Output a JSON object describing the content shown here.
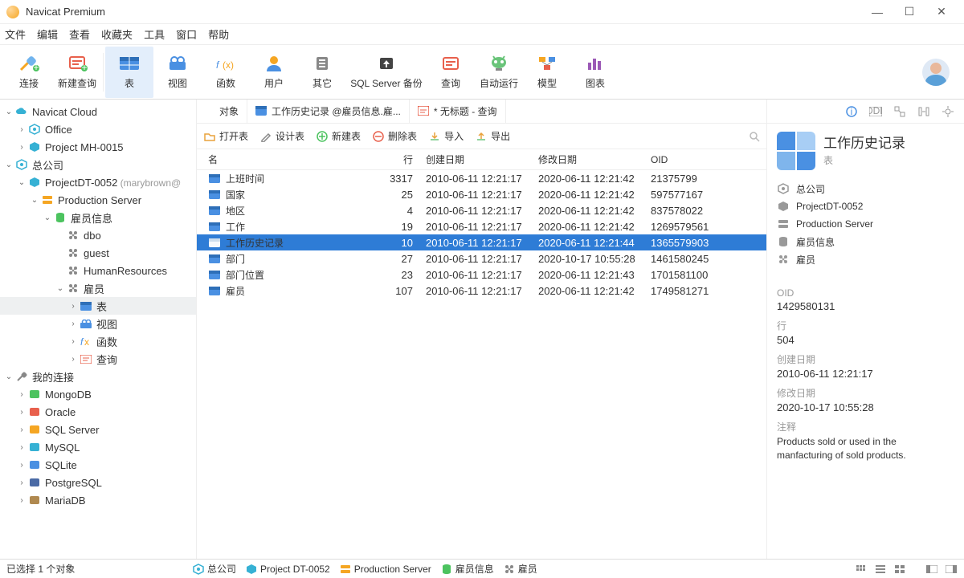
{
  "window": {
    "title": "Navicat Premium"
  },
  "menu": [
    "文件",
    "编辑",
    "查看",
    "收藏夹",
    "工具",
    "窗口",
    "帮助"
  ],
  "toolbar": [
    {
      "key": "connect",
      "label": "连接"
    },
    {
      "key": "newquery",
      "label": "新建查询"
    },
    {
      "key": "table",
      "label": "表",
      "active": true
    },
    {
      "key": "view",
      "label": "视图"
    },
    {
      "key": "function",
      "label": "函数"
    },
    {
      "key": "user",
      "label": "用户"
    },
    {
      "key": "other",
      "label": "其它"
    },
    {
      "key": "backup",
      "label": "SQL Server 备份",
      "wide": true
    },
    {
      "key": "query",
      "label": "查询"
    },
    {
      "key": "autorun",
      "label": "自动运行"
    },
    {
      "key": "model",
      "label": "模型"
    },
    {
      "key": "chart",
      "label": "图表"
    }
  ],
  "tree": [
    {
      "d": 0,
      "tw": "v",
      "ic": "cloud",
      "tx": "Navicat Cloud"
    },
    {
      "d": 1,
      "tw": ">",
      "ic": "org",
      "tx": "Office"
    },
    {
      "d": 1,
      "tw": ">",
      "ic": "proj",
      "tx": "Project MH-0015"
    },
    {
      "d": 0,
      "tw": "v",
      "ic": "org",
      "tx": "总公司"
    },
    {
      "d": 1,
      "tw": "v",
      "ic": "proj",
      "tx": "ProjectDT-0052",
      "sub": " (marybrown@"
    },
    {
      "d": 2,
      "tw": "v",
      "ic": "srv",
      "tx": "Production Server"
    },
    {
      "d": 3,
      "tw": "v",
      "ic": "db",
      "tx": "雇员信息"
    },
    {
      "d": 4,
      "tw": "",
      "ic": "schema",
      "tx": "dbo"
    },
    {
      "d": 4,
      "tw": "",
      "ic": "schema",
      "tx": "guest"
    },
    {
      "d": 4,
      "tw": "",
      "ic": "schema",
      "tx": "HumanResources"
    },
    {
      "d": 4,
      "tw": "v",
      "ic": "schema",
      "tx": "雇员"
    },
    {
      "d": 5,
      "tw": ">",
      "ic": "table",
      "tx": "表",
      "sel": true
    },
    {
      "d": 5,
      "tw": ">",
      "ic": "view",
      "tx": "视图"
    },
    {
      "d": 5,
      "tw": ">",
      "ic": "fx",
      "tx": "函数"
    },
    {
      "d": 5,
      "tw": ">",
      "ic": "query",
      "tx": "查询"
    },
    {
      "d": 0,
      "tw": "v",
      "ic": "myconn",
      "tx": "我的连接"
    },
    {
      "d": 1,
      "tw": ">",
      "ic": "mongo",
      "tx": "MongoDB"
    },
    {
      "d": 1,
      "tw": ">",
      "ic": "oracle",
      "tx": "Oracle"
    },
    {
      "d": 1,
      "tw": ">",
      "ic": "mssql",
      "tx": "SQL Server"
    },
    {
      "d": 1,
      "tw": ">",
      "ic": "mysql",
      "tx": "MySQL"
    },
    {
      "d": 1,
      "tw": ">",
      "ic": "sqlite",
      "tx": "SQLite"
    },
    {
      "d": 1,
      "tw": ">",
      "ic": "pg",
      "tx": "PostgreSQL"
    },
    {
      "d": 1,
      "tw": ">",
      "ic": "maria",
      "tx": "MariaDB"
    }
  ],
  "tabs": [
    {
      "label": "对象",
      "kind": "objects"
    },
    {
      "label": "工作历史记录 @雇员信息.雇...",
      "kind": "table"
    },
    {
      "label": "* 无标题 - 查询",
      "kind": "query"
    }
  ],
  "subtoolbar": {
    "open": "打开表",
    "design": "设计表",
    "new": "新建表",
    "delete": "删除表",
    "import": "导入",
    "export": "导出"
  },
  "columns": {
    "name": "名",
    "rows": "行",
    "created": "创建日期",
    "modified": "修改日期",
    "oid": "OID"
  },
  "table_rows": [
    {
      "n": "上班时间",
      "r": "3317",
      "c": "2010-06-11 12:21:17",
      "m": "2020-06-11 12:21:42",
      "o": "21375799"
    },
    {
      "n": "国家",
      "r": "25",
      "c": "2010-06-11 12:21:17",
      "m": "2020-06-11 12:21:42",
      "o": "597577167"
    },
    {
      "n": "地区",
      "r": "4",
      "c": "2010-06-11 12:21:17",
      "m": "2020-06-11 12:21:42",
      "o": "837578022"
    },
    {
      "n": "工作",
      "r": "19",
      "c": "2010-06-11 12:21:17",
      "m": "2020-06-11 12:21:42",
      "o": "1269579561"
    },
    {
      "n": "工作历史记录",
      "r": "10",
      "c": "2010-06-11 12:21:17",
      "m": "2020-06-11 12:21:44",
      "o": "1365579903",
      "sel": true
    },
    {
      "n": "部门",
      "r": "27",
      "c": "2010-06-11 12:21:17",
      "m": "2020-10-17 10:55:28",
      "o": "1461580245"
    },
    {
      "n": "部门位置",
      "r": "23",
      "c": "2010-06-11 12:21:17",
      "m": "2020-06-11 12:21:43",
      "o": "1701581100"
    },
    {
      "n": "雇员",
      "r": "107",
      "c": "2010-06-11 12:21:17",
      "m": "2020-06-11 12:21:42",
      "o": "1749581271"
    }
  ],
  "detail": {
    "title": "工作历史记录",
    "subtitle": "表",
    "path": [
      "总公司",
      "ProjectDT-0052",
      "Production Server",
      "雇员信息",
      "雇员"
    ],
    "oid_label": "OID",
    "oid": "1429580131",
    "rows_label": "行",
    "rows": "504",
    "created_label": "创建日期",
    "created": "2010-06-11 12:21:17",
    "modified_label": "修改日期",
    "modified": "2020-10-17 10:55:28",
    "comment_label": "注释",
    "comment": "Products sold or used in the manfacturing of sold products."
  },
  "status": {
    "selection": "已选择 1 个对象",
    "crumbs": [
      {
        "ic": "org",
        "tx": "总公司"
      },
      {
        "ic": "proj",
        "tx": "Project DT-0052"
      },
      {
        "ic": "srv",
        "tx": "Production Server"
      },
      {
        "ic": "db",
        "tx": "雇员信息"
      },
      {
        "ic": "schema",
        "tx": "雇员"
      }
    ]
  }
}
